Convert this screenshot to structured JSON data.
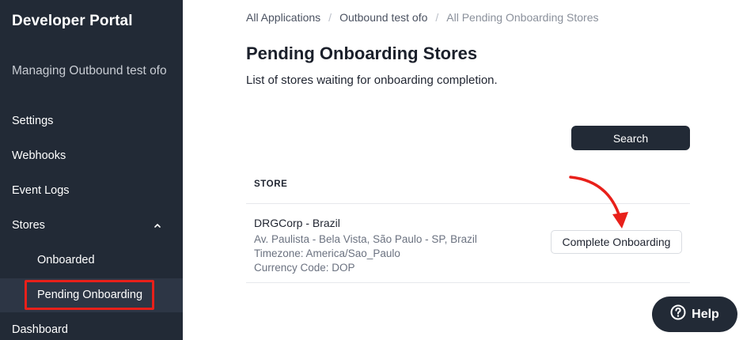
{
  "sidebar": {
    "brand": "Developer Portal",
    "managing": "Managing Outbound test ofo",
    "items": {
      "settings": "Settings",
      "webhooks": "Webhooks",
      "event_logs": "Event Logs",
      "stores": "Stores",
      "onboarded": "Onboarded",
      "pending_onboarding": "Pending Onboarding",
      "dashboard": "Dashboard"
    },
    "stores_icon": "chevron-up-icon",
    "highlight_color": "#e8201a"
  },
  "breadcrumb": {
    "items": [
      "All Applications",
      "Outbound test ofo",
      "All Pending Onboarding Stores"
    ],
    "separator": "/"
  },
  "main": {
    "title": "Pending Onboarding Stores",
    "description": "List of stores waiting for onboarding completion.",
    "search_label": "Search",
    "table": {
      "header_store": "STORE",
      "rows": [
        {
          "name": "DRGCorp - Brazil",
          "address": "Av. Paulista - Bela Vista, São Paulo - SP, Brazil",
          "timezone": "Timezone: America/Sao_Paulo",
          "currency": "Currency Code: DOP",
          "action": "Complete Onboarding"
        }
      ]
    }
  },
  "help": {
    "label": "Help",
    "icon": "question-circle-icon"
  },
  "colors": {
    "sidebar_bg": "#222a36",
    "accent_dark": "#222a36",
    "annotation_red": "#e8201a"
  }
}
